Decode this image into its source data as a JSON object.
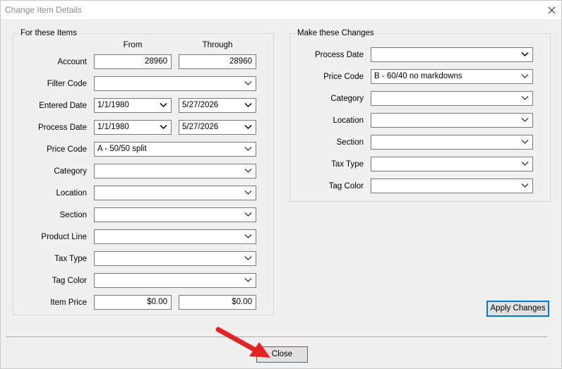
{
  "window": {
    "title": "Change Item Details"
  },
  "left_group": {
    "legend": "For these Items",
    "col_from": "From",
    "col_through": "Through",
    "account": {
      "label": "Account",
      "from": "28960",
      "through": "28960"
    },
    "filter_code": {
      "label": "Filter Code",
      "value": ""
    },
    "entered_date": {
      "label": "Entered Date",
      "from": "1/1/1980",
      "through": "5/27/2026"
    },
    "process_date": {
      "label": "Process Date",
      "from": "1/1/1980",
      "through": "5/27/2026"
    },
    "price_code": {
      "label": "Price Code",
      "value": "A - 50/50 split"
    },
    "category": {
      "label": "Category",
      "value": ""
    },
    "location": {
      "label": "Location",
      "value": ""
    },
    "section": {
      "label": "Section",
      "value": ""
    },
    "product_line": {
      "label": "Product Line",
      "value": ""
    },
    "tax_type": {
      "label": "Tax Type",
      "value": ""
    },
    "tag_color": {
      "label": "Tag Color",
      "value": ""
    },
    "item_price": {
      "label": "Item Price",
      "from": "$0.00",
      "through": "$0.00"
    }
  },
  "right_group": {
    "legend": "Make these Changes",
    "process_date": {
      "label": "Process Date",
      "value": ""
    },
    "price_code": {
      "label": "Price Code",
      "value": "B - 60/40 no markdowns"
    },
    "category": {
      "label": "Category",
      "value": ""
    },
    "location": {
      "label": "Location",
      "value": ""
    },
    "section": {
      "label": "Section",
      "value": ""
    },
    "tax_type": {
      "label": "Tax Type",
      "value": ""
    },
    "tag_color": {
      "label": "Tag Color",
      "value": ""
    }
  },
  "buttons": {
    "apply": "Apply Changes",
    "close": "Close"
  },
  "colors": {
    "focus_border": "#0078d7",
    "annotation_arrow": "#e52222"
  },
  "icons": {
    "dropdown": "chevron-down-icon",
    "window_close": "close-icon",
    "annotation": "red-arrow-icon"
  }
}
